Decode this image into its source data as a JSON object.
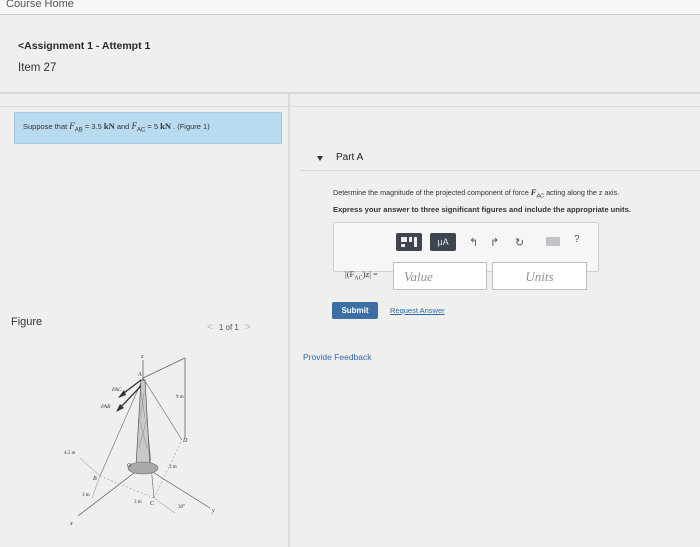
{
  "header": {
    "course_home": "Course Home"
  },
  "nav": {
    "back_link": "<Assignment 1 - Attempt 1",
    "item_label": "Item 27"
  },
  "given": {
    "prefix": "Suppose that ",
    "fab_sym": "F",
    "fab_sub": "AB",
    "fab_eq": " = 3.5 ",
    "fab_unit": "kN",
    "and": " and ",
    "fac_sym": "F",
    "fac_sub": "AC",
    "fac_eq": " = 5 ",
    "fac_unit": "kN",
    "figure_ref": " . (Figure 1)"
  },
  "part": {
    "title": "Part A",
    "question_a": "Determine the magnitude of the projected component of force ",
    "question_sym": "F",
    "question_sub": "AC",
    "question_b": " acting along the z axis.",
    "instructions": "Express your answer to three significant figures and include the appropriate units.",
    "toolbar": {
      "mu_label": "μA",
      "help": "?"
    },
    "lhs_label": "|(F",
    "lhs_sub": "AC",
    "lhs_tail": ")z| =",
    "value_placeholder": "Value",
    "units_placeholder": "Units",
    "submit_label": "Submit",
    "request_answer": "Request Answer"
  },
  "feedback": {
    "label": "Provide Feedback"
  },
  "figure": {
    "label": "Figure",
    "pager_prev": "<",
    "pager_count": "1 of 1",
    "pager_next": ">",
    "labels": {
      "z": "z",
      "a": "A",
      "fac": "FAC",
      "fab": "FAB",
      "nine_m": "9 m",
      "four_five_m": "4.5 m",
      "o": "O",
      "d": "D",
      "three_m_right": "3 m",
      "b": "B",
      "three_m_left": "3 m",
      "three_m_bottom": "3 m",
      "c": "C",
      "angle": "30°",
      "x": "x",
      "y": "y"
    }
  }
}
